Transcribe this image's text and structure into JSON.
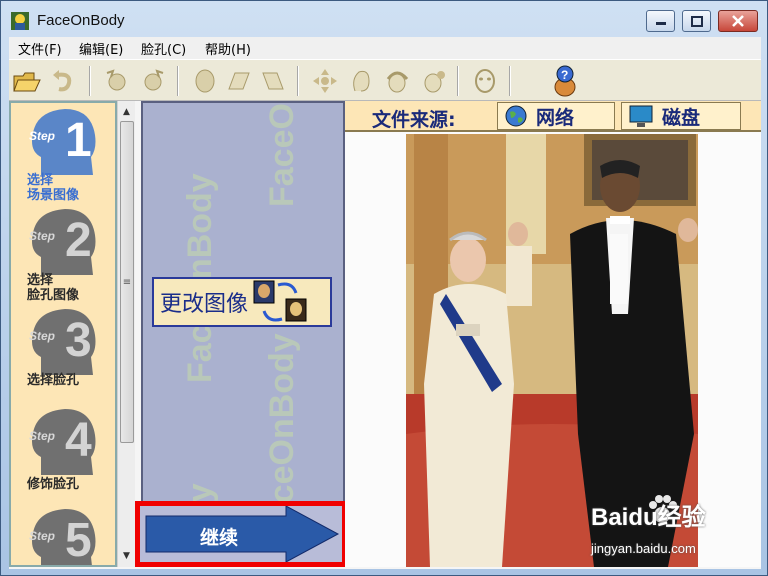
{
  "window": {
    "title": "FaceOnBody",
    "icon": "faceonbody-app-icon"
  },
  "menu": {
    "items": [
      "文件(F)",
      "编辑(E)",
      "脸孔(C)",
      "帮助(H)"
    ]
  },
  "toolbar": {
    "icons": [
      "open-folder-icon",
      "undo-icon",
      "rotate-left-icon",
      "rotate-right-icon",
      "face-icon",
      "skew-left-icon",
      "skew-right-icon",
      "move-icon",
      "face-outline-icon",
      "face-hair-icon",
      "face-hair-bun-icon",
      "face-mask-icon",
      "help-icon"
    ]
  },
  "steps": [
    {
      "word": "Step",
      "number": "1",
      "label": "选择\n场景图像",
      "active": true
    },
    {
      "word": "Step",
      "number": "2",
      "label": "选择\n脸孔图像",
      "active": false
    },
    {
      "word": "Step",
      "number": "3",
      "label": "选择脸孔",
      "active": false
    },
    {
      "word": "Step",
      "number": "4",
      "label": "修饰脸孔",
      "active": false
    },
    {
      "word": "Step",
      "number": "5",
      "label": "",
      "active": false
    }
  ],
  "middle": {
    "watermark": "FaceOnBody",
    "change_image_label": "更改图像",
    "continue_label": "继续"
  },
  "source": {
    "label": "文件来源:",
    "network_label": "网络",
    "disk_label": "磁盘"
  },
  "overlay": {
    "brand": "Baidu经验",
    "url": "jingyan.baidu.com"
  },
  "colors": {
    "steps_bg": "#fde6b6",
    "active_step_text": "#3a6fd1",
    "mid_bg": "#aab1cf",
    "highlight_border": "#f00000",
    "arrow_blue": "#2a5aa8"
  }
}
